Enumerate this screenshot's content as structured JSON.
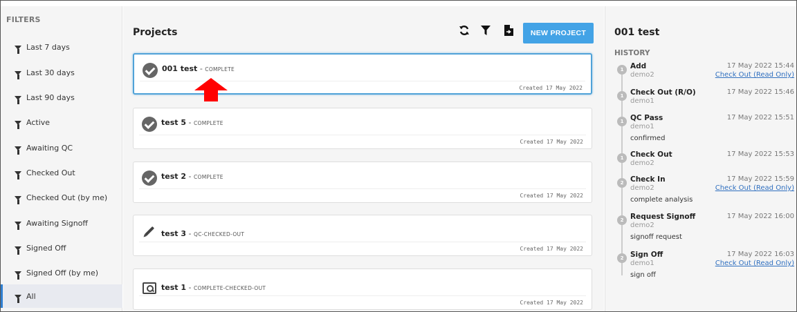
{
  "sidebar": {
    "heading": "FILTERS",
    "items": [
      {
        "label": "Last 7 days"
      },
      {
        "label": "Last 30 days"
      },
      {
        "label": "Last 90 days"
      },
      {
        "label": "Active"
      },
      {
        "label": "Awaiting QC"
      },
      {
        "label": "Checked Out"
      },
      {
        "label": "Checked Out (by me)"
      },
      {
        "label": "Awaiting Signoff"
      },
      {
        "label": "Signed Off"
      },
      {
        "label": "Signed Off (by me)"
      },
      {
        "label": "All",
        "selected": true
      }
    ]
  },
  "main": {
    "title": "Projects",
    "toolbar": {
      "refresh_icon": "refresh-icon",
      "filter_icon": "filter-icon",
      "export_icon": "file-export-icon",
      "new_project_label": "NEW PROJECT"
    },
    "projects": [
      {
        "name": "001 test",
        "separator": " - ",
        "status": "COMPLETE",
        "created": "Created 17 May 2022",
        "icon": "check-badge-icon",
        "selected": true
      },
      {
        "name": "test 5",
        "separator": " - ",
        "status": "COMPLETE",
        "created": "Created 17 May 2022",
        "icon": "check-badge-icon"
      },
      {
        "name": "test 2",
        "separator": " - ",
        "status": "COMPLETE",
        "created": "Created 17 May 2022",
        "icon": "check-badge-icon"
      },
      {
        "name": "test 3",
        "separator": " - ",
        "status": "QC-CHECKED-OUT",
        "created": "Created 17 May 2022",
        "icon": "pencil-icon"
      },
      {
        "name": "test 1",
        "separator": " - ",
        "status": "COMPLETE-CHECKED-OUT",
        "created": "Created 17 May 2022",
        "icon": "search-icon"
      }
    ]
  },
  "detail": {
    "title": "001 test",
    "history_heading": "HISTORY",
    "events": [
      {
        "step": "1",
        "action": "Add",
        "user": "demo2",
        "time": "17 May 2022 15:44",
        "link": "Check Out (Read Only)",
        "note": ""
      },
      {
        "step": "1",
        "action": "Check Out (R/O)",
        "user": "demo1",
        "time": "17 May 2022 15:46",
        "link": "",
        "note": ""
      },
      {
        "step": "1",
        "action": "QC Pass",
        "user": "demo1",
        "time": "17 May 2022 15:51",
        "link": "",
        "note": "confirmed"
      },
      {
        "step": "1",
        "action": "Check Out",
        "user": "demo2",
        "time": "17 May 2022 15:53",
        "link": "",
        "note": ""
      },
      {
        "step": "2",
        "action": "Check In",
        "user": "demo2",
        "time": "17 May 2022 15:59",
        "link": "Check Out (Read Only)",
        "note": "complete analysis"
      },
      {
        "step": "2",
        "action": "Request Signoff",
        "user": "demo2",
        "time": "17 May 2022 16:00",
        "link": "",
        "note": "signoff request"
      },
      {
        "step": "2",
        "action": "Sign Off",
        "user": "demo1",
        "time": "17 May 2022 16:03",
        "link": "Check Out (Read Only)",
        "note": "sign off"
      }
    ]
  },
  "colors": {
    "accent": "#43a3e6",
    "selected_border": "#4fa2d8",
    "arrow": "#ff0000",
    "link": "#2f6fbf"
  }
}
